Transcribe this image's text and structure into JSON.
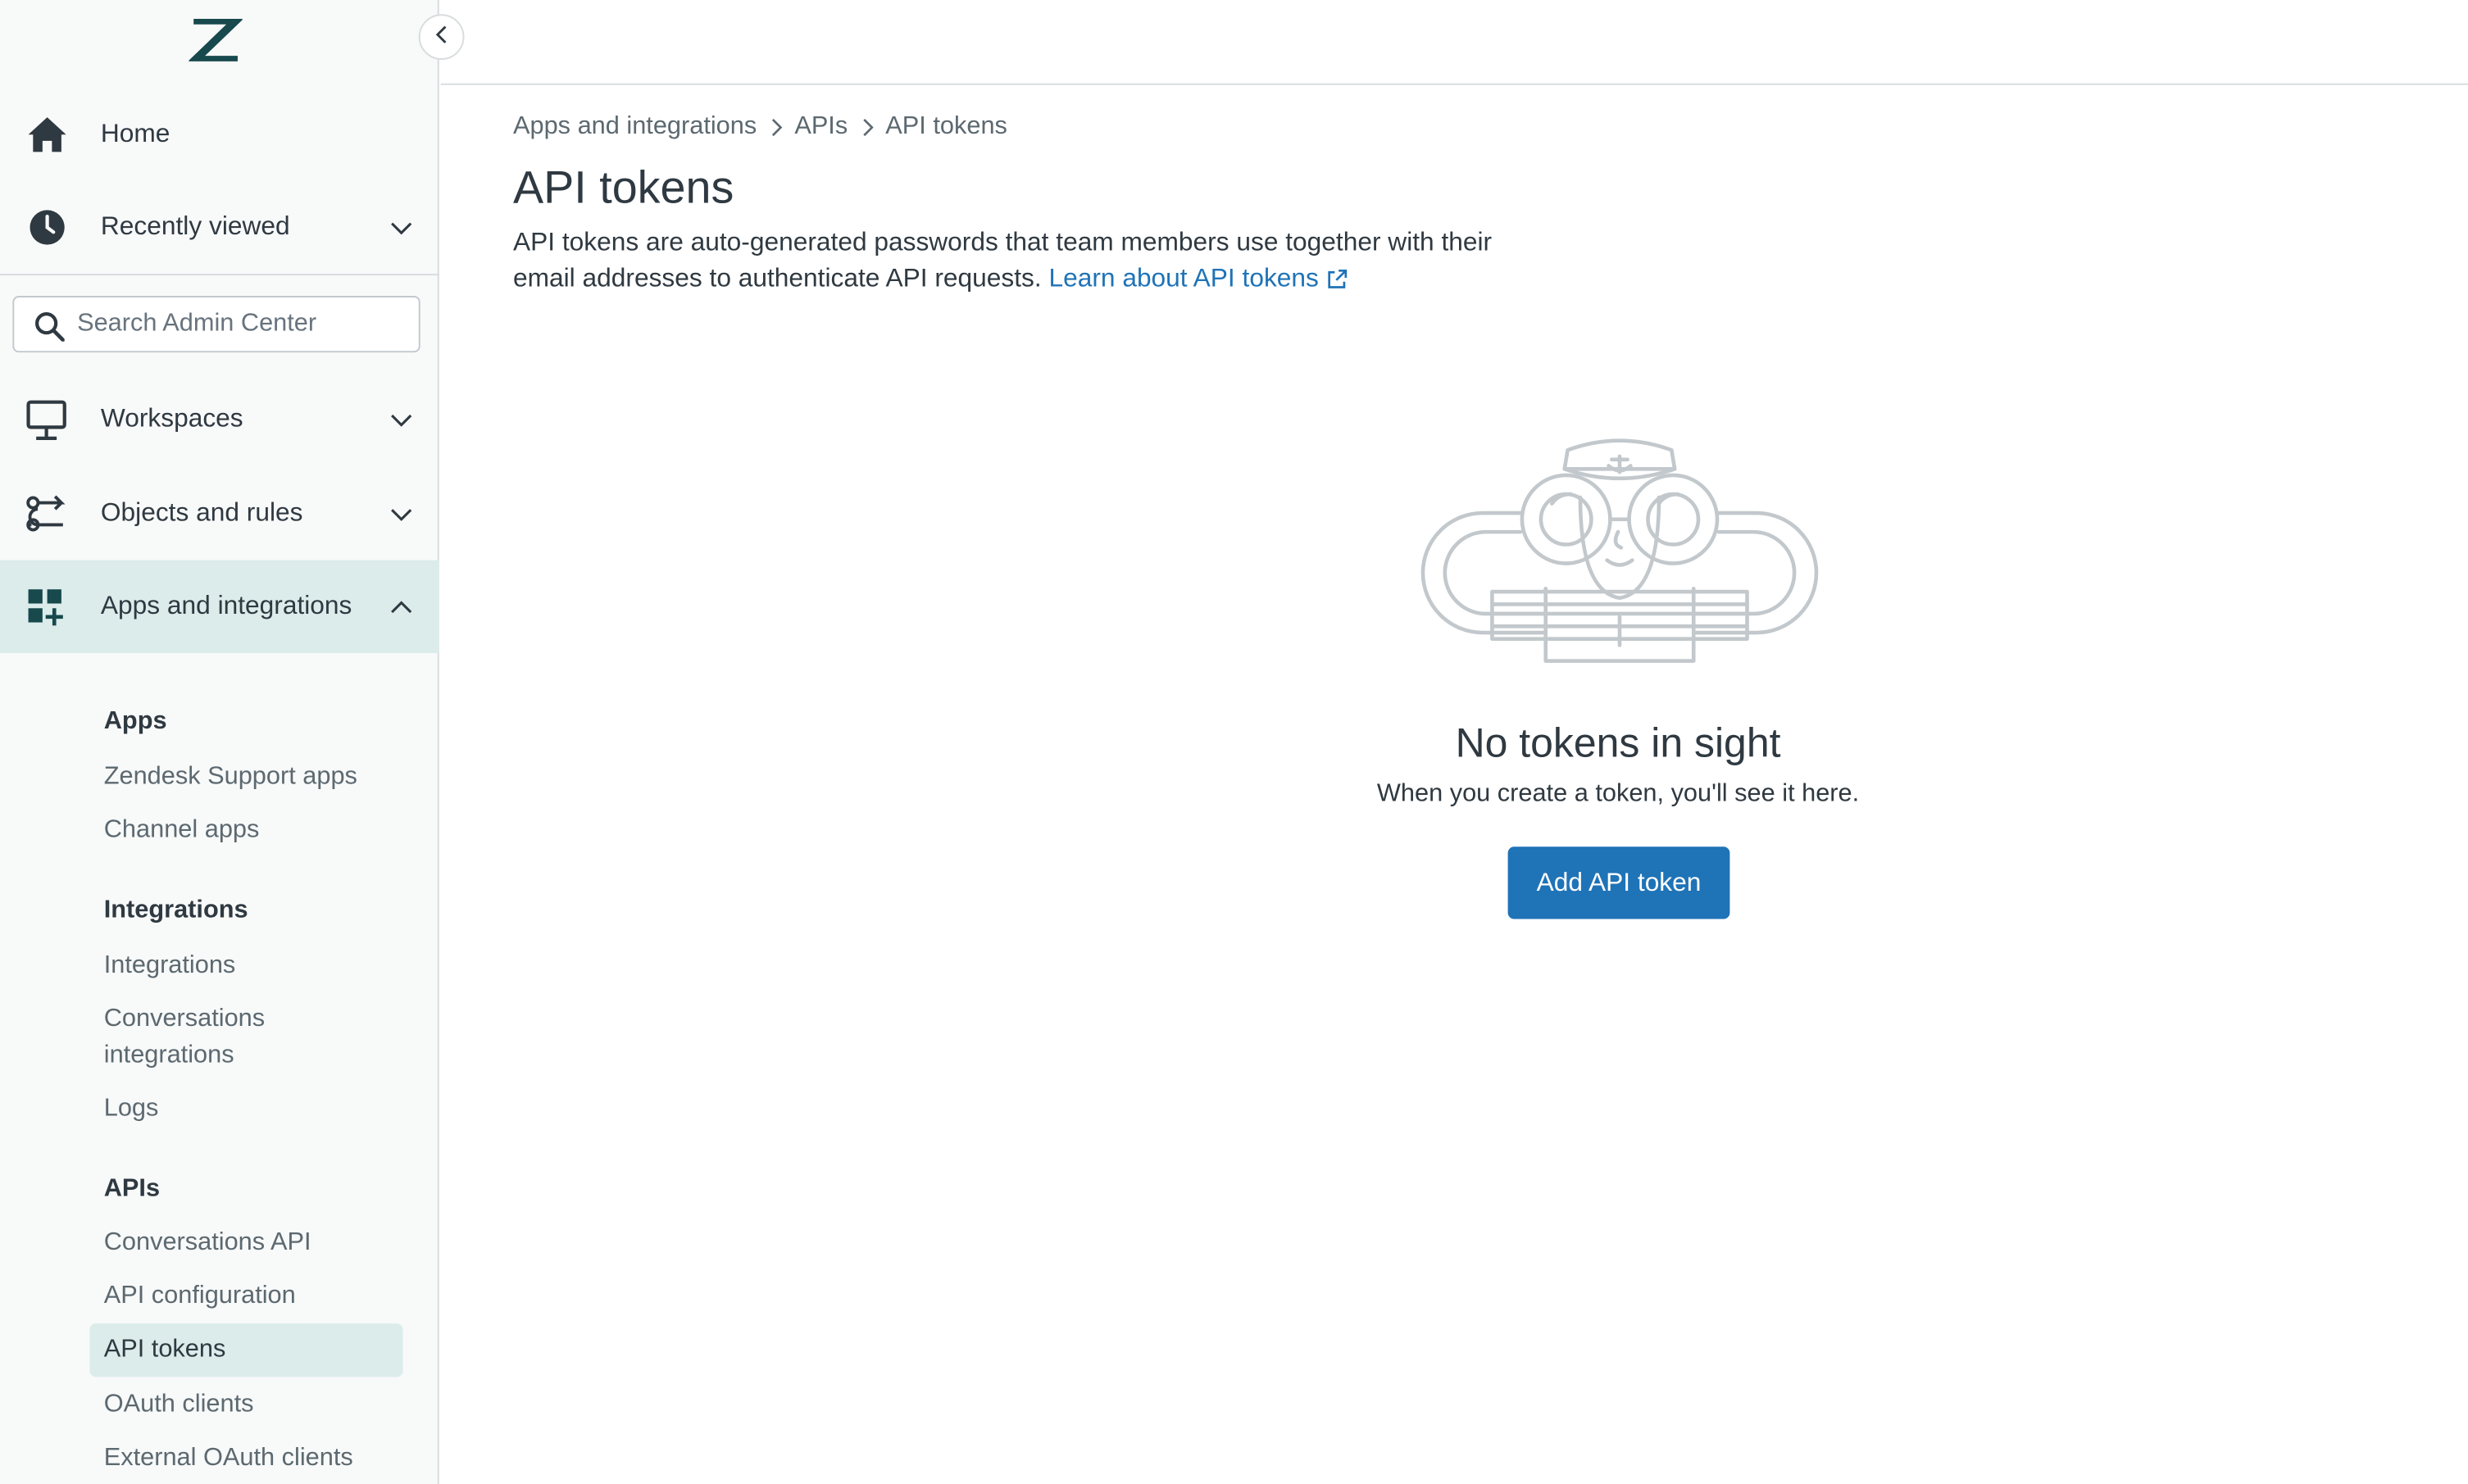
{
  "sidebar": {
    "logo_icon": "zendesk-logo",
    "collapse_icon": "chevron-left-icon",
    "nav": {
      "home": {
        "label": "Home",
        "icon": "home-icon"
      },
      "recently_viewed": {
        "label": "Recently viewed",
        "icon": "clock-icon"
      },
      "workspaces": {
        "label": "Workspaces",
        "icon": "monitor-icon"
      },
      "objects_rules": {
        "label": "Objects and rules",
        "icon": "objects-rules-icon"
      },
      "apps_integrations": {
        "label": "Apps and integrations",
        "icon": "apps-integrations-icon",
        "expanded": true
      }
    },
    "search": {
      "placeholder": "Search Admin Center",
      "value": ""
    },
    "sections": {
      "apps": {
        "heading": "Apps",
        "links": [
          "Zendesk Support apps",
          "Channel apps"
        ]
      },
      "integrations": {
        "heading": "Integrations",
        "links": [
          "Integrations",
          "Conversations integrations",
          "Logs"
        ]
      },
      "apis": {
        "heading": "APIs",
        "links": [
          "Conversations API",
          "API configuration",
          "API tokens",
          "OAuth clients",
          "External OAuth clients"
        ],
        "selected": "API tokens"
      }
    }
  },
  "breadcrumb": {
    "items": [
      "Apps and integrations",
      "APIs",
      "API tokens"
    ]
  },
  "page": {
    "title": "API tokens",
    "description": "API tokens are auto-generated passwords that team members use together with their email addresses to authenticate API requests.",
    "learn_link": "Learn about API tokens"
  },
  "empty_state": {
    "illustration": "sailor-binoculars-illustration",
    "title": "No tokens in sight",
    "subtitle": "When you create a token, you'll see it here.",
    "button_label": "Add API token"
  },
  "colors": {
    "accent": "#1f73b7",
    "active_nav_bg": "#dbeceb",
    "sidebar_bg": "#f8f9f9",
    "text": "#2f3941"
  }
}
